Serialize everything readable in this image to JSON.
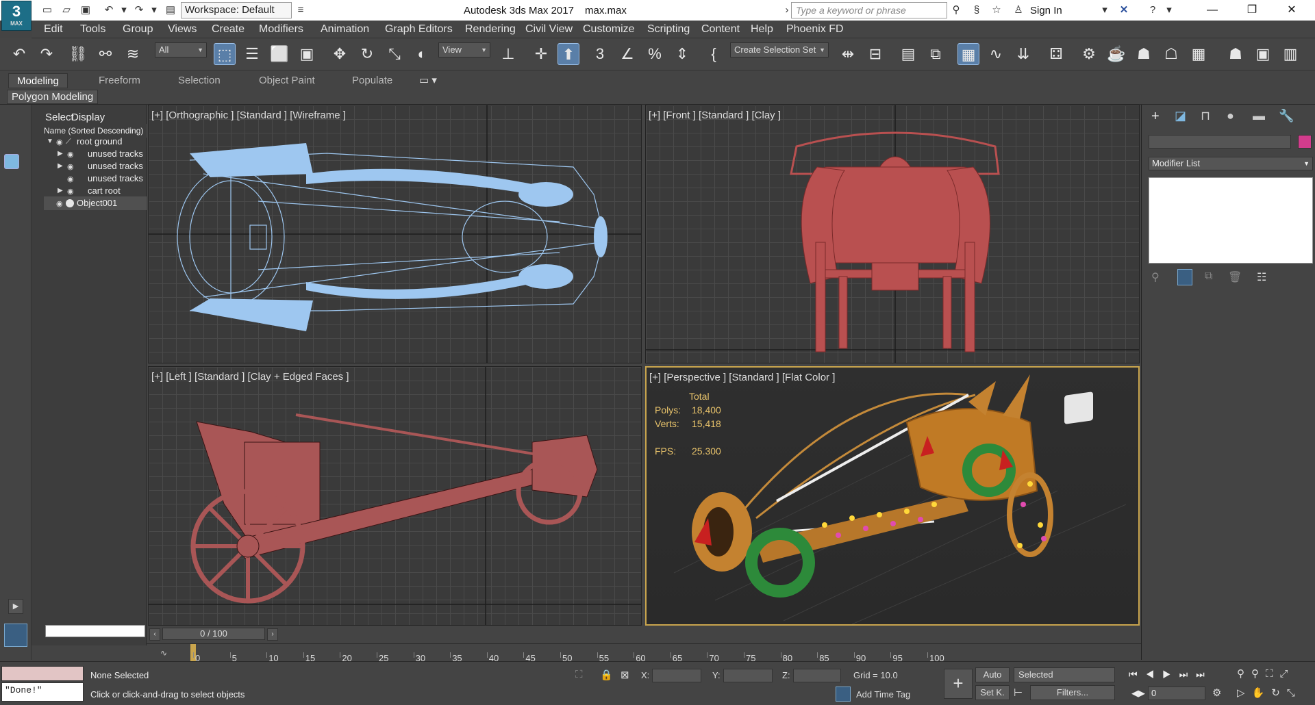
{
  "app": {
    "title": "Autodesk 3ds Max 2017",
    "file": "max.max",
    "logo": "3",
    "logo_sub": "MAX"
  },
  "workspace": {
    "label": "Workspace: Default"
  },
  "search": {
    "placeholder": "Type a keyword or phrase"
  },
  "account": {
    "sign_in": "Sign In"
  },
  "menu": [
    "Edit",
    "Tools",
    "Group",
    "Views",
    "Create",
    "Modifiers",
    "Animation",
    "Graph Editors",
    "Rendering",
    "Civil View",
    "Customize",
    "Scripting",
    "Content",
    "Help",
    "Phoenix FD"
  ],
  "toolbar": {
    "filter": "All",
    "ref_coord": "View",
    "selection_set": "Create Selection Set"
  },
  "ribbon": {
    "tabs": [
      "Modeling",
      "Freeform",
      "Selection",
      "Object Paint",
      "Populate"
    ],
    "panel": "Polygon Modeling"
  },
  "scene_explorer": {
    "tabs": [
      "Select",
      "Display"
    ],
    "column": "Name (Sorted Descending)",
    "items": [
      "root ground",
      "unused tracks",
      "unused tracks",
      "unused tracks",
      "cart root",
      "Object001"
    ]
  },
  "viewports": {
    "top_left": "[+] [Orthographic ] [Standard ] [Wireframe ]",
    "top_right": "[+] [Front ] [Standard ] [Clay ]",
    "bottom_left": "[+] [Left ] [Standard ] [Clay + Edged Faces ]",
    "bottom_right": "[+] [Perspective ] [Standard ] [Flat Color ]",
    "stats": {
      "header": "Total",
      "polys_label": "Polys:",
      "polys": "18,400",
      "verts_label": "Verts:",
      "verts": "15,418",
      "fps_label": "FPS:",
      "fps": "25.300"
    }
  },
  "command_panel": {
    "modifier_list": "Modifier List",
    "accent_color": "#d23c8c"
  },
  "timeline": {
    "frame": "0 / 100",
    "ticks": [
      "0",
      "5",
      "10",
      "15",
      "20",
      "25",
      "30",
      "35",
      "40",
      "45",
      "50",
      "55",
      "60",
      "65",
      "70",
      "75",
      "80",
      "85",
      "90",
      "95",
      "100"
    ]
  },
  "status": {
    "selection": "None Selected",
    "prompt": "Click or click-and-drag to select objects",
    "maxscript": "\"Done!\"",
    "x_label": "X:",
    "y_label": "Y:",
    "z_label": "Z:",
    "grid": "Grid = 10.0",
    "auto_key": "Auto",
    "key_mode": "Selected",
    "set_key": "Set K.",
    "filters": "Filters...",
    "add_time_tag": "Add Time Tag",
    "current_frame": "0"
  }
}
